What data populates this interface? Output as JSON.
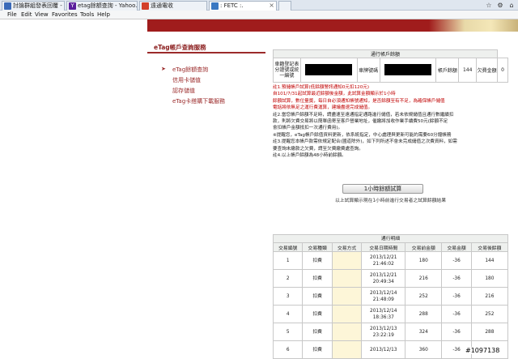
{
  "tabs": [
    {
      "label": "討論群組發表回覆 - M...",
      "icon_color": "#3a6ab8"
    },
    {
      "label": "etag餘額查詢 - Yahoo...",
      "icon_color": "#5a1e9c",
      "icon_glyph": "Y"
    },
    {
      "label": "遠通電收",
      "icon_color": "#d3402a"
    },
    {
      "label": ": FETC :.",
      "icon_color": "#3a78c2",
      "active": true
    }
  ],
  "menu": [
    "File",
    "Edit",
    "View",
    "Favorites",
    "Tools",
    "Help"
  ],
  "sidebar": {
    "title": "eTag帳戶查詢服務",
    "items": [
      "eTag餘額查詢",
      "信用卡儲值",
      "認存儲值",
      "eTag卡搭購下載服務"
    ]
  },
  "balance": {
    "caption": "通行帳戶餘額",
    "reg_label": "車籍登記表\n分證號或統\n一編號",
    "plate_label": "車牌號碼",
    "account_balance_label": "帳戶餘額",
    "account_balance": "144",
    "insufficient_label": "欠費金額",
    "insufficient": "0"
  },
  "notes": [
    {
      "text": "註1.預儲帳戶試算(低餘額警訊通知0元扣120元)",
      "red": true
    },
    {
      "text": "    自101/7/31起試算最近餘額後金額，此試算金額顯示於1小時",
      "red": true
    },
    {
      "text": "    餘額試算，數位量獎，每日自必須通知帳號通知，是否餘額至有不足，為確保帳戶儲值",
      "red": true
    },
    {
      "text": "    電話將依無足之運行費運算，建議盡速完成儲值。",
      "red": true
    },
    {
      "text": "註2.當您帳戶餘額不足時，請盡速至遠通指定通路進行儲值，若未依規儲值且通行數繼續扣"
    },
    {
      "text": "    款，則將欠費交易將以簡單函寄至客戶營業地址，催繳將加收作業手續費50元(餘額不足"
    },
    {
      "text": "    會扣帳戶金額抵扣一次通行費用)。"
    },
    {
      "text": "※提醒您，eTag帳戶餘值資料更新，依系統指定，中心處理與更新可能約需要60分鐘帳務"
    },
    {
      "text": "註3.提醒您本帳戶款需依規定配合(國道除外)，如下列所述不會未完成儲值之次費資料，如需"
    },
    {
      "text": "    要查詢未繳款之欠費，請至欠費繳費處查詢。"
    },
    {
      "text": "註4.以上帳戶餘額為48小時前餘額。"
    }
  ],
  "button": {
    "label": "1小時餘額試算",
    "note": "以上試算顯示現在1小時前進行交易者之試算餘額結果"
  },
  "transactions": {
    "caption": "通行明細",
    "headers": [
      "交易編號",
      "交易種類",
      "交易方式",
      "交易日期時間",
      "交易前金額",
      "交易金額",
      "交易後餘額"
    ],
    "rows": [
      {
        "no": "1",
        "type": "扣費",
        "way": "",
        "date": "2013/12/21",
        "time": "21:46:02",
        "before": "180",
        "amount": "-36",
        "after": "144"
      },
      {
        "no": "2",
        "type": "扣費",
        "way": "",
        "date": "2013/12/21",
        "time": "20:49:34",
        "before": "216",
        "amount": "-36",
        "after": "180"
      },
      {
        "no": "3",
        "type": "扣費",
        "way": "",
        "date": "2013/12/14",
        "time": "21:48:09",
        "before": "252",
        "amount": "-36",
        "after": "216"
      },
      {
        "no": "4",
        "type": "扣費",
        "way": "",
        "date": "2013/12/14",
        "time": "18:36:37",
        "before": "288",
        "amount": "-36",
        "after": "252"
      },
      {
        "no": "5",
        "type": "扣費",
        "way": "",
        "date": "2013/12/13",
        "time": "23:22:19",
        "before": "324",
        "amount": "-36",
        "after": "288"
      },
      {
        "no": "6",
        "type": "扣費",
        "way": "",
        "date": "2013/12/13",
        "time": "",
        "before": "360",
        "amount": "-36",
        "after": "324"
      }
    ]
  },
  "watermark": "#1097138"
}
